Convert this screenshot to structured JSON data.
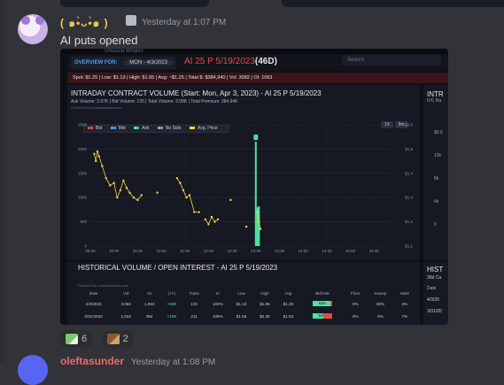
{
  "message": {
    "username": "( ๑•̀ᴗ•̀๑ )",
    "timestamp": "Yesterday at 1:07 PM",
    "text": "AI puts opened"
  },
  "embed": {
    "brand": "Unusual Whales",
    "overview_label": "OVERVIEW FOR:",
    "overview_date": "MON - 4/3/2023",
    "contract_title": "AI 25 P 5/19/2023",
    "contract_days": "(46D)",
    "search_placeholder": "Search",
    "stats": {
      "spot": "Spot: $1.25",
      "low": "Low: $1.13",
      "high": "High: $1.65",
      "avg": "Avg: ~$1.25",
      "total": "Total $: $384,940",
      "vol": "Vol: 3082",
      "oi": "OI: 1063"
    },
    "chart_heading": "INTRADAY CONTRACT VOLUME (Start: Mon, Apr 3, 2023) - AI 25 P 5/19/2023",
    "chart_subline": "Ask Volume: 2.67K  |  Bid Volume: 135  |  Total Volume: 3.08K  |  Total Premium: 384.94K",
    "chart_credit": "Powered by unusualwhales.com",
    "timeframes": [
      "1d",
      "5m"
    ],
    "legend": [
      {
        "label": "Bid",
        "color": "#e84848"
      },
      {
        "label": "Mid",
        "color": "#4ea0f5"
      },
      {
        "label": "Ask",
        "color": "#4be3a1"
      },
      {
        "label": "No Side",
        "color": "#9aa4b8"
      },
      {
        "label": "Avg. Price",
        "color": "#f5d442"
      }
    ],
    "right_panel_title": "INTR",
    "right_panel_sub": "IVC Ra",
    "right_panel_ticks": [
      "$0.5",
      "12k",
      "8k",
      "4k",
      "0"
    ],
    "hist_heading": "HISTORICAL VOLUME / OPEN INTEREST - AI 25 P 5/19/2023",
    "hist_credit": "Powered by unusualwhales.com",
    "hist_right_title": "HIST",
    "hist_right_sub": "30d Ca",
    "hist_right_col": "Date",
    "hist_right_rows": [
      "4/3/20",
      "3/31/20"
    ],
    "hist_columns": [
      "Date",
      "Vol",
      "OI",
      "(+/-)",
      "Trans",
      "IV",
      "Low",
      "High",
      "Avg",
      "Bid/Ask",
      "Floor",
      "Sweep",
      "Multi"
    ],
    "hist_rows": [
      {
        "date": "4/3/2023",
        "vol": "3,082",
        "oi": "1,063",
        "chg": "+669",
        "trans": "133",
        "iv": "103%",
        "low": "$1.13",
        "high": "$1.65",
        "avg": "$1.25",
        "ask_pct": "93%",
        "ask_frac": 0.93,
        "floor": "0%",
        "sweep": "26%",
        "multi": "3%"
      },
      {
        "date": "3/31/2023",
        "vol": "1,002",
        "oi": "394",
        "chg": "+108",
        "trans": "211",
        "iv": "109%",
        "low": "$1.55",
        "high": "$2.35",
        "avg": "$1.83",
        "ask_pct": "54%",
        "ask_frac": 0.54,
        "floor": "0%",
        "sweep": "0%",
        "multi": "7%"
      }
    ]
  },
  "chart_data": {
    "type": "bar",
    "title": "INTRADAY CONTRACT VOLUME (Start: Mon, Apr 3, 2023) - AI 25 P 5/19/2023",
    "x_ticks": [
      "09:30",
      "10:00",
      "10:30",
      "11:00",
      "11:30",
      "12:00",
      "12:30",
      "13:00",
      "13:30",
      "14:00",
      "14:30",
      "15:00",
      "15:30"
    ],
    "y_ticks_left": [
      "0",
      "500",
      "1000",
      "1500",
      "2000",
      "2500"
    ],
    "y_ticks_right": [
      "$1.1",
      "$1.2",
      "$1.3",
      "$1.4",
      "$1.5",
      "$1.6"
    ],
    "ylim_left": [
      0,
      2500
    ],
    "ylim_right": [
      1.1,
      1.6
    ],
    "series": [
      {
        "name": "Ask",
        "color": "#4be3a1",
        "points": [
          [
            "13:00",
            2150
          ],
          [
            "13:02",
            800
          ],
          [
            "13:04",
            820
          ]
        ]
      },
      {
        "name": "Avg. Price",
        "color": "#f5d442",
        "points": [
          [
            "09:35",
            1.48
          ],
          [
            "09:37",
            1.45
          ],
          [
            "09:39",
            1.49
          ],
          [
            "09:41",
            1.47
          ],
          [
            "09:45",
            1.43
          ],
          [
            "09:50",
            1.38
          ],
          [
            "09:55",
            1.35
          ],
          [
            "10:00",
            1.36
          ],
          [
            "10:04",
            1.3
          ],
          [
            "10:08",
            1.33
          ],
          [
            "10:12",
            1.37
          ],
          [
            "10:16",
            1.34
          ],
          [
            "10:20",
            1.32
          ],
          [
            "10:25",
            1.3
          ],
          [
            "10:30",
            1.29
          ],
          [
            "10:35",
            1.31
          ],
          [
            "10:55",
            1.32
          ],
          [
            "11:20",
            1.38
          ],
          [
            "11:24",
            1.36
          ],
          [
            "11:28",
            1.33
          ],
          [
            "11:32",
            1.3
          ],
          [
            "11:36",
            1.31
          ],
          [
            "11:42",
            1.24
          ],
          [
            "11:48",
            1.24
          ],
          [
            "11:56",
            1.21
          ],
          [
            "12:00",
            1.19
          ],
          [
            "12:04",
            1.22
          ],
          [
            "12:08",
            1.2
          ],
          [
            "12:12",
            1.21
          ],
          [
            "12:28",
            1.29
          ],
          [
            "12:48",
            1.18
          ],
          [
            "13:02",
            1.24
          ],
          [
            "13:04",
            1.2
          ],
          [
            "13:06",
            1.17
          ]
        ]
      }
    ]
  },
  "reactions": [
    {
      "emoji": "money-with-wings",
      "count": "6"
    },
    {
      "emoji": "bear-money",
      "count": "2"
    }
  ],
  "next_message": {
    "username": "oleftasunder",
    "timestamp": "Yesterday at 1:08 PM"
  }
}
